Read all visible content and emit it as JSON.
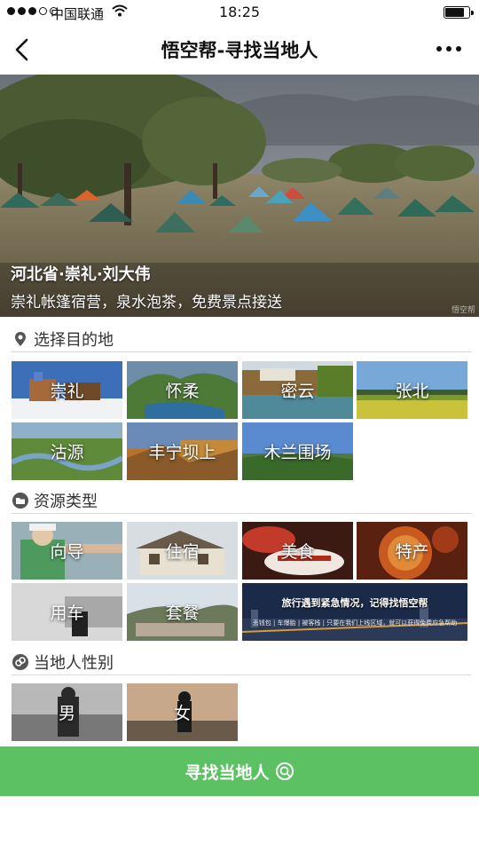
{
  "status_bar": {
    "carrier": "中国联通",
    "time": "18:25",
    "battery_level": 0.8
  },
  "nav": {
    "title": "悟空帮-寻找当地人",
    "back_icon": "chevron-left-icon",
    "more_icon": "more-dots-icon"
  },
  "hero": {
    "person": "河北省·崇礼·刘大伟",
    "description": "崇礼帐篷宿营，泉水泡茶，免费景点接送",
    "watermark": "悟空帮"
  },
  "destinations": {
    "title": "选择目的地",
    "icon": "location-pin-icon",
    "items": [
      "崇礼",
      "怀柔",
      "密云",
      "张北",
      "沽源",
      "丰宁坝上",
      "木兰围场"
    ]
  },
  "resources": {
    "title": "资源类型",
    "icon": "folder-icon",
    "items": [
      "向导",
      "住宿",
      "美食",
      "特产",
      "用车",
      "套餐"
    ],
    "banner_title": "旅行遇到紧急情况，记得找悟空帮",
    "banner_sub": "丢钱包 | 车爆胎 | 被客栈 | 只要在我们上线区域，就可以获得免费应急帮助"
  },
  "gender": {
    "title": "当地人性别",
    "icon": "gender-icon",
    "items": [
      "男",
      "女"
    ]
  },
  "find_button": {
    "label": "寻找当地人",
    "icon": "search-icon"
  },
  "colors": {
    "accent_green": "#5cc163",
    "divider": "#d9d9d9"
  }
}
